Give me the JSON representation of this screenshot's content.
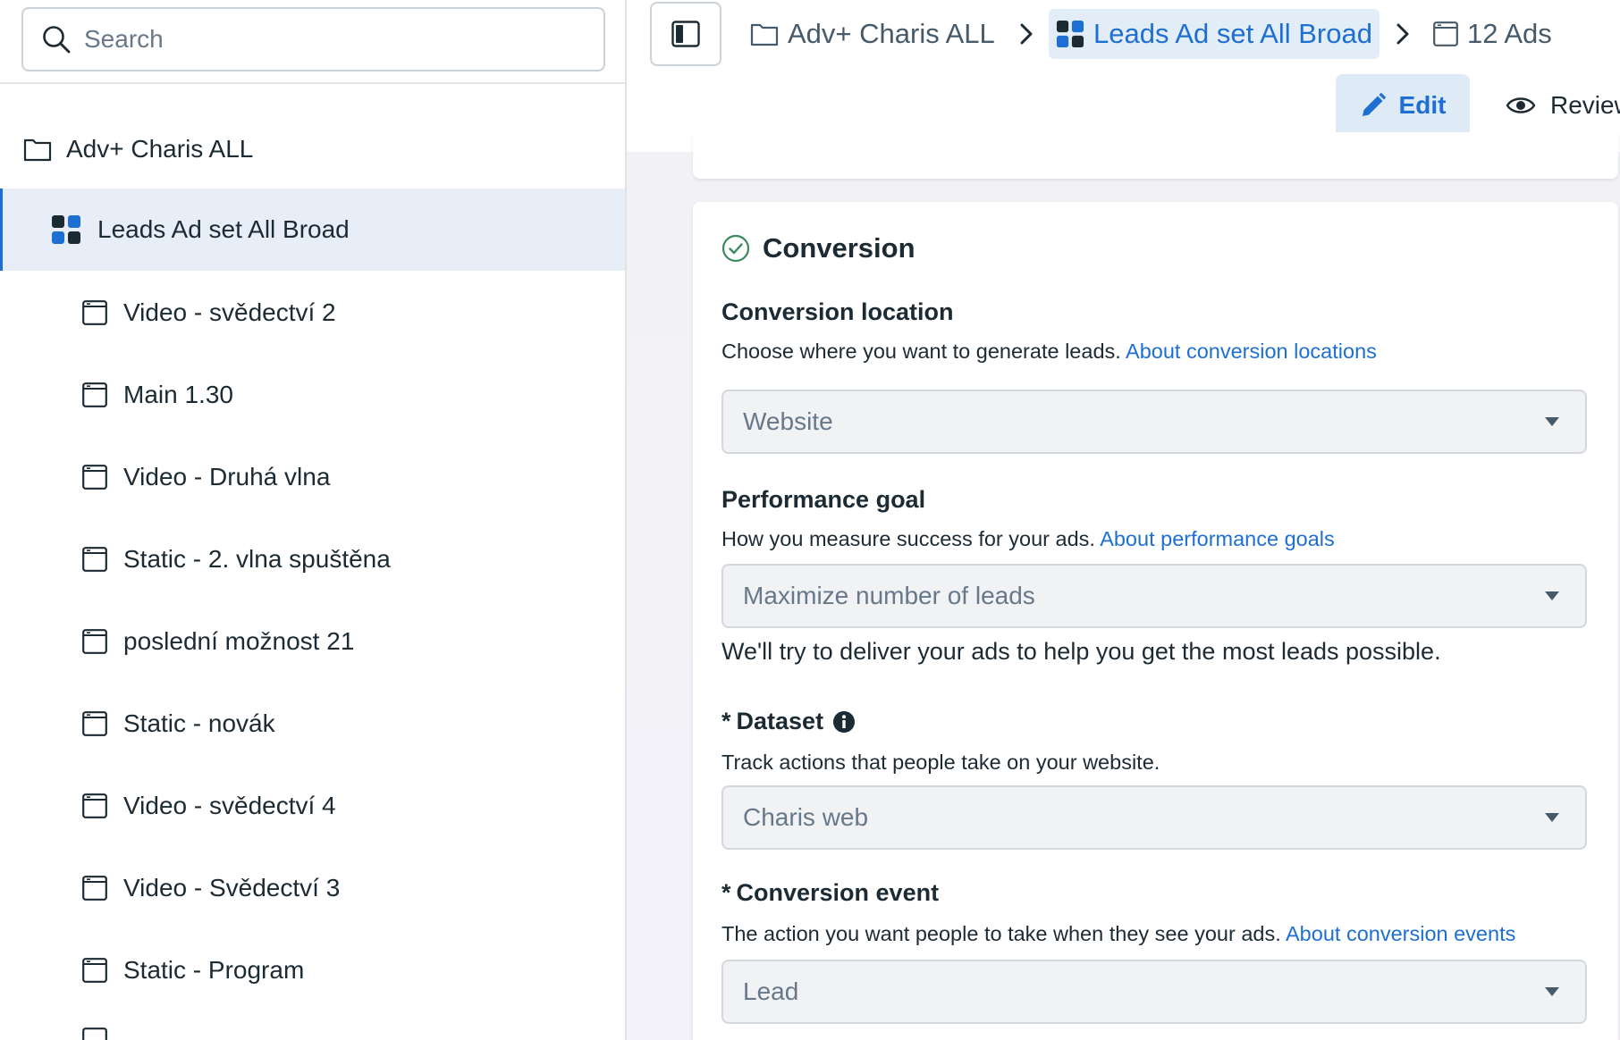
{
  "search": {
    "placeholder": "Search",
    "icon": "search-icon"
  },
  "tree": {
    "campaign": {
      "label": "Adv+ Charis ALL",
      "icon": "folder-icon"
    },
    "adset": {
      "label": "Leads Ad set All Broad",
      "icon": "adset-grid-icon"
    },
    "ads": [
      {
        "label": "Video - svědectví 2"
      },
      {
        "label": "Main 1.30"
      },
      {
        "label": "Video - Druhá vlna"
      },
      {
        "label": "Static - 2. vlna spuštěna"
      },
      {
        "label": "poslední možnost 21"
      },
      {
        "label": "Static - novák"
      },
      {
        "label": "Video - svědectví 4"
      },
      {
        "label": "Video - Svědectví 3"
      },
      {
        "label": "Static - Program"
      }
    ]
  },
  "breadcrumb": {
    "campaign": "Adv+ Charis ALL",
    "adset": "Leads Ad set All Broad",
    "ads": "12 Ads"
  },
  "toolbar": {
    "edit_label": "Edit",
    "review_label": "Review"
  },
  "conversion": {
    "title": "Conversion",
    "location": {
      "title": "Conversion location",
      "desc": "Choose where you want to generate leads.",
      "link": "About conversion locations",
      "value": "Website"
    },
    "performance": {
      "title": "Performance goal",
      "desc": "How you measure success for your ads.",
      "link": "About performance goals",
      "value": "Maximize number of leads",
      "helper": "We'll try to deliver your ads to help you get the most leads possible."
    },
    "dataset": {
      "required_mark": "*",
      "title": "Dataset",
      "desc": "Track actions that people take on your website.",
      "value": "Charis web"
    },
    "event": {
      "required_mark": "*",
      "title": "Conversion event",
      "desc": "The action you want people to take when they see your ads.",
      "link": "About conversion events",
      "value": "Lead"
    }
  },
  "colors": {
    "accent": "#1d6fd1",
    "selected_bg": "#e7eef8",
    "success": "#3a8a5f"
  }
}
